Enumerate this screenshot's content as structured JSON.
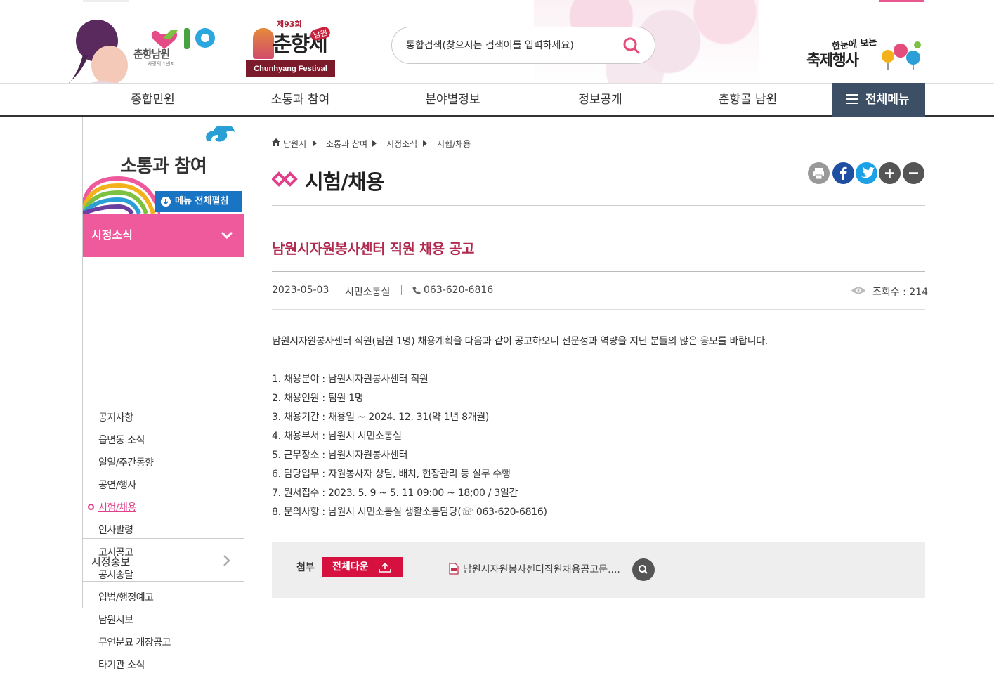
{
  "header": {
    "city_name": "춘향남원",
    "city_slogan": "사랑의 1번지",
    "festival_number": "제93회",
    "festival_title": "춘향제",
    "festival_sub": "남원",
    "festival_en": "Chunhyang Festival",
    "search_placeholder": "통합검색(찾으시는 검색어를 입력하세요)",
    "events_small": "한눈에 보는",
    "events_big": "축제행사"
  },
  "gnb": {
    "items": [
      "종합민원",
      "소통과 참여",
      "분야별정보",
      "정보공개",
      "춘향골 남원"
    ],
    "all_menu": "전체메뉴"
  },
  "lnb": {
    "title": "소통과 참여",
    "expand_label": "메뉴 전체펼침",
    "active_section": "시정소식",
    "sub_items": [
      "공지사항",
      "읍면동 소식",
      "일일/주간동향",
      "공연/행사",
      "시험/채용",
      "인사발령",
      "고시공고",
      "공시송달",
      "입법/행정예고",
      "남원시보",
      "무연분묘 개장공고",
      "타기관 소식"
    ],
    "current_item": "시험/채용",
    "next_section": "시정홍보"
  },
  "breadcrumb": [
    "남원시",
    "소통과 참여",
    "시정소식",
    "시험/채용"
  ],
  "page_title": "시험/채용",
  "post": {
    "title": "남원시자원봉사센터 직원 채용 공고",
    "date": "2023-05-03",
    "department": "시민소통실",
    "phone": "063-620-6816",
    "views": "조회수 : 214",
    "intro": "남원시자원봉사센터 직원(팀원 1명) 채용계획을 다음과 같이 공고하오니 전문성과 역량을 지닌 분들의 많은 응모를 바랍니다.",
    "lines": [
      "1. 채용분야 : 남원시자원봉사센터 직원",
      "2. 채용인원 : 팀원 1명",
      "3. 채용기간 : 채용일 ~ 2024. 12. 31(약 1년 8개월)",
      "4. 채용부서 : 남원시 시민소통실",
      "5. 근무장소 : 남원시자원봉사센터",
      "6. 담당업무 : 자원봉사자 상담, 배치, 현장관리 등 실무 수행",
      "7. 원서접수 : 2023. 5. 9 ~ 5. 11 09:00 ~ 18;00 / 3일간",
      "8. 문의사항 : 남원시 시민소통실 생활소통담당(☏ 063-620-6816)"
    ]
  },
  "attachment": {
    "label": "첨부",
    "download_all": "전체다운",
    "file_name": "남원시자원봉사센터직원채용공고문...."
  },
  "colors": {
    "accent_pink": "#ef5a9d",
    "title_red": "#b0294f",
    "gnb_all_bg": "#3d4f65",
    "expand_blue": "#1a74c4",
    "download_red": "#d6103f"
  },
  "icons": [
    "search-icon",
    "home-icon",
    "print-icon",
    "facebook-icon",
    "twitter-icon",
    "zoom-in-icon",
    "zoom-out-icon",
    "eye-icon",
    "phone-icon",
    "menu-icon",
    "chevron-down-icon",
    "chevron-right-icon",
    "download-icon",
    "file-icon",
    "preview-icon"
  ]
}
